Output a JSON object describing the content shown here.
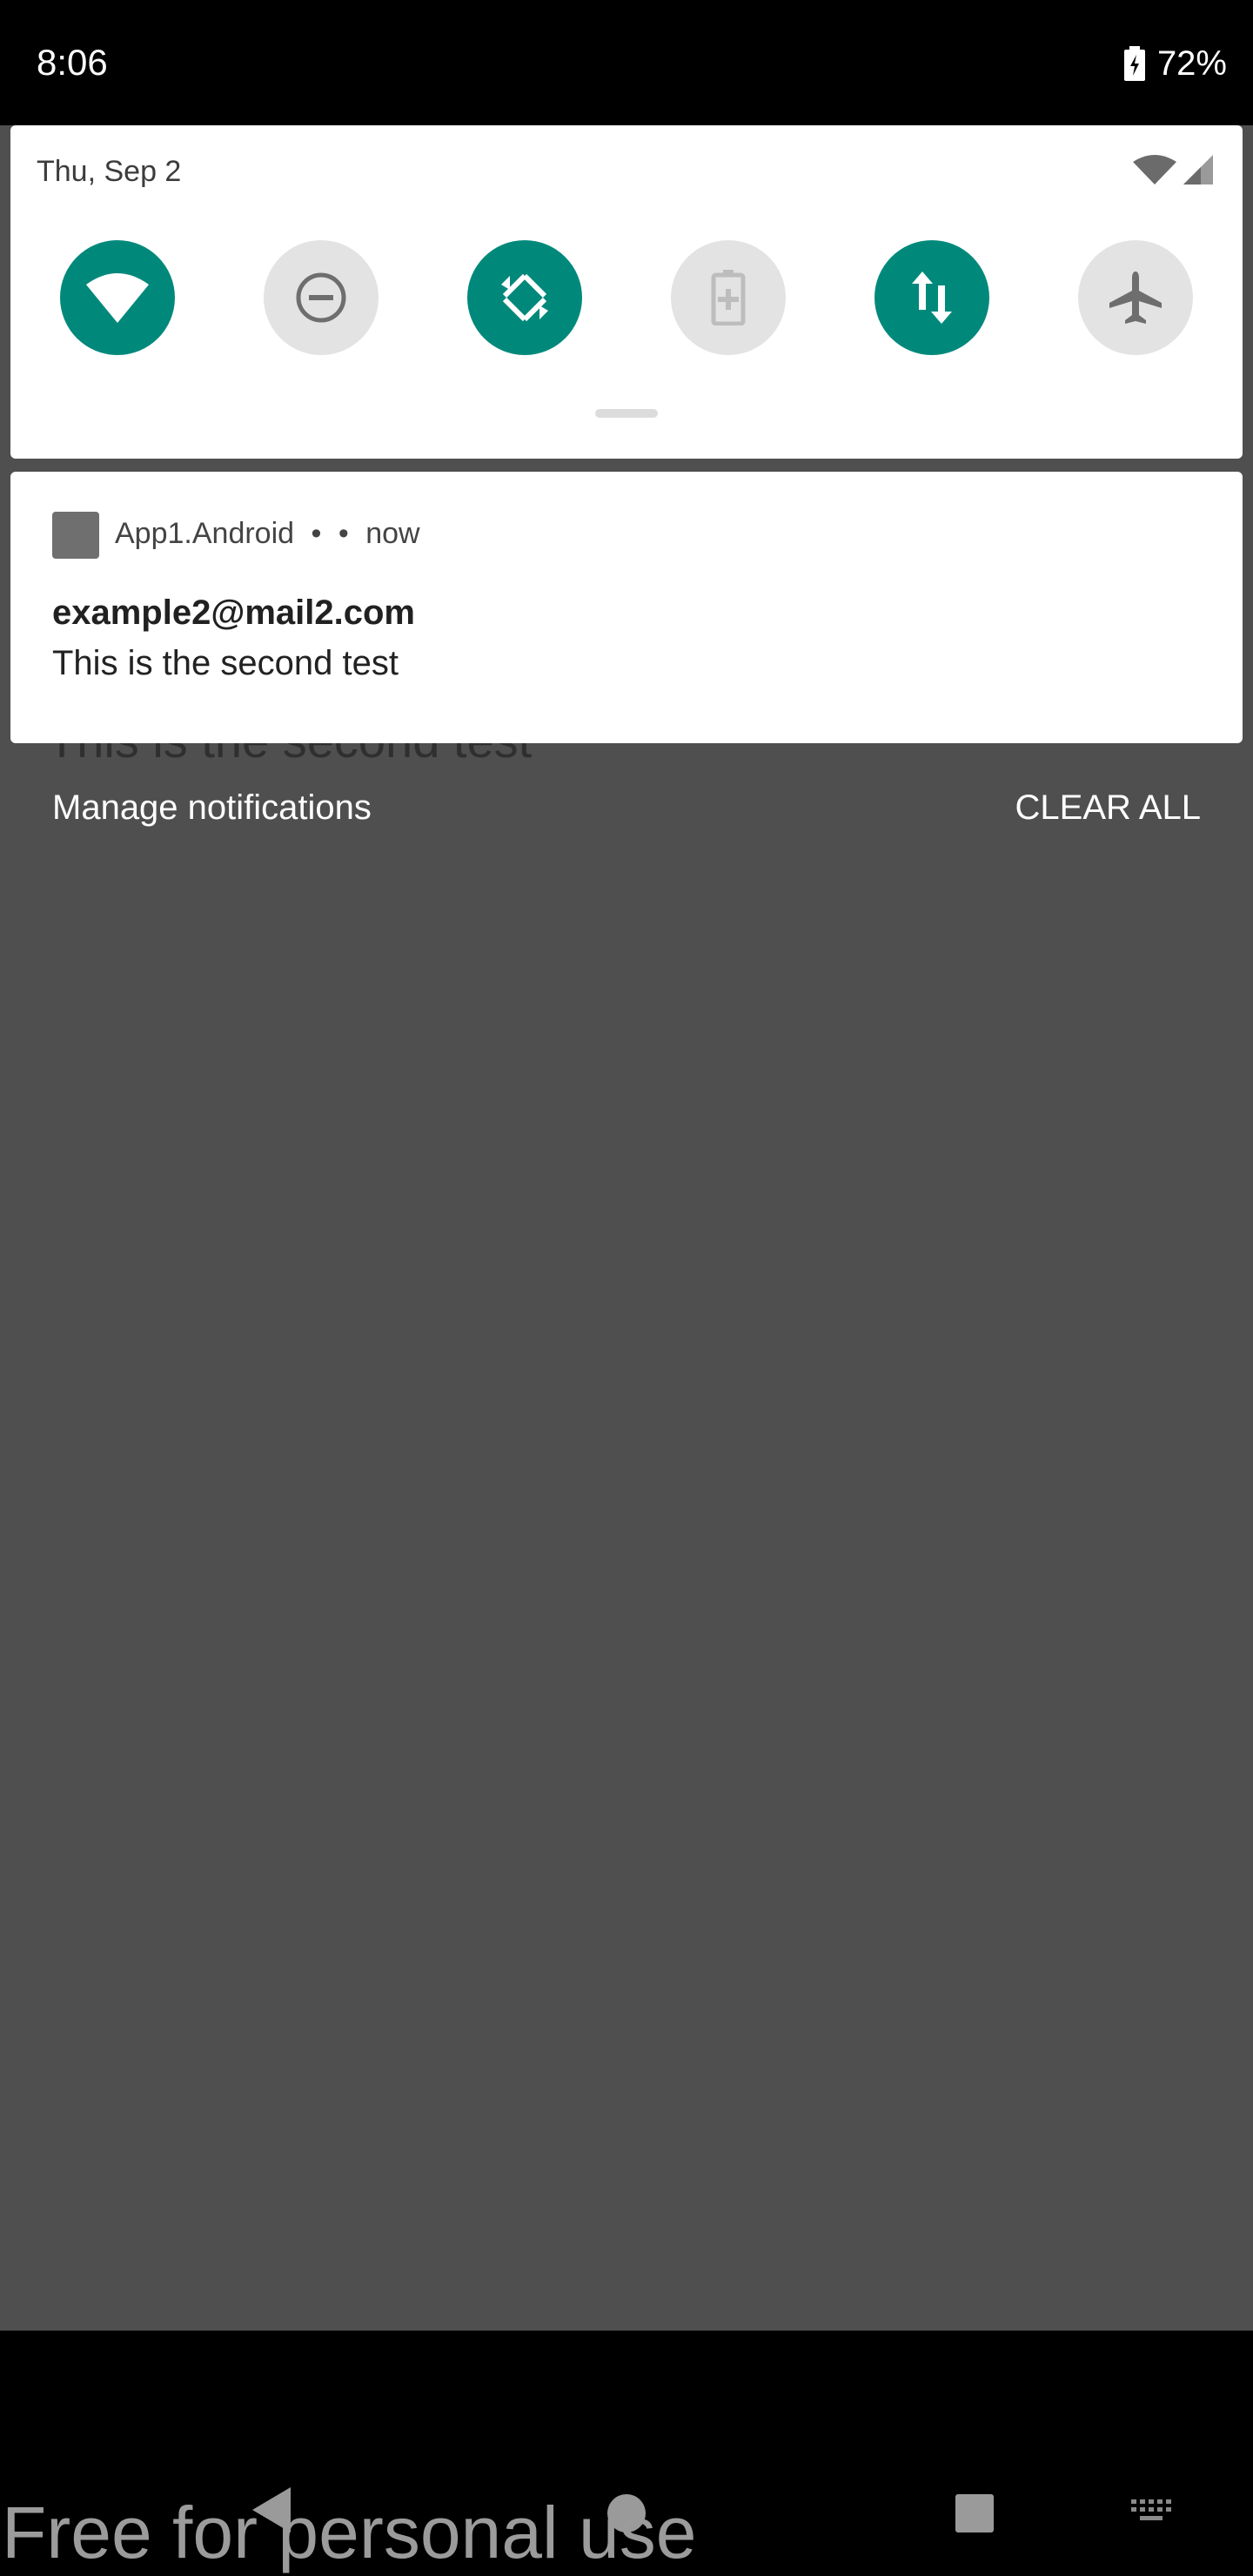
{
  "status_bar": {
    "time": "8:06",
    "battery_percent": "72%",
    "battery_icon": "battery-charging-icon"
  },
  "quick_settings": {
    "date": "Thu, Sep 2",
    "status_icons": [
      "wifi-icon",
      "cellular-signal-icon"
    ],
    "tiles": [
      {
        "name": "wifi",
        "icon": "wifi-icon",
        "active": true
      },
      {
        "name": "do-not-disturb",
        "icon": "do-not-disturb-icon",
        "active": false
      },
      {
        "name": "auto-rotate",
        "icon": "auto-rotate-icon",
        "active": true
      },
      {
        "name": "battery-saver",
        "icon": "battery-saver-icon",
        "active": false
      },
      {
        "name": "mobile-data",
        "icon": "mobile-data-icon",
        "active": true
      },
      {
        "name": "airplane-mode",
        "icon": "airplane-icon",
        "active": false
      }
    ],
    "accent_color": "#00897b"
  },
  "notification": {
    "app_name": "App1.Android",
    "separator": "•",
    "time": "now",
    "title": "example2@mail2.com",
    "text": "This is the second test"
  },
  "background_app": {
    "partial_text": "This is the second test"
  },
  "footer": {
    "manage_label": "Manage notifications",
    "clear_all_label": "CLEAR ALL"
  },
  "watermark": {
    "text": "Free for personal use"
  }
}
